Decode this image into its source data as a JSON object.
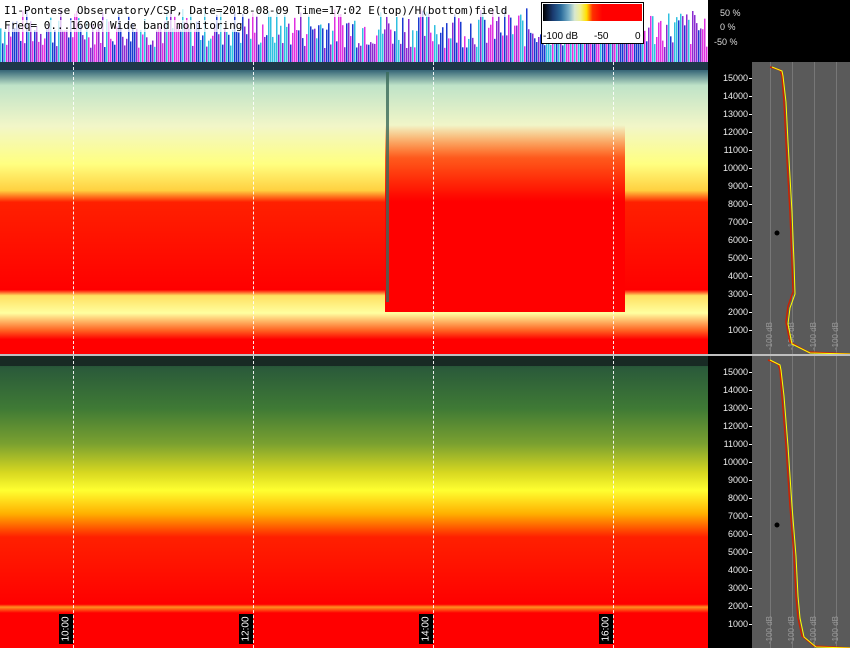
{
  "header": {
    "title": "I1-Pontese Observatory/CSP, Date=2018-08-09 Time=17:02 E(top)/H(bottom)field",
    "subtitle": "Freq= 0...16000 Wide band monitoring"
  },
  "colorbar": {
    "min_label": "-100 dB",
    "mid_label": "-50",
    "max_label": "0"
  },
  "percent_scale": [
    "50 %",
    "0 %",
    "-50 %"
  ],
  "frequency_axis": {
    "labels": [
      "15000",
      "14000",
      "13000",
      "12000",
      "11000",
      "10000",
      "9000",
      "8000",
      "7000",
      "6000",
      "5000",
      "4000",
      "3000",
      "2000",
      "1000"
    ]
  },
  "profile_ticks": [
    "-100 dB",
    "-100 dB",
    "-100 dB",
    "-100 dB"
  ],
  "time_labels": [
    "10:00",
    "12:00",
    "14:00",
    "16:00"
  ],
  "colors": {
    "red": "#ff0000",
    "yellow": "#ffff60",
    "green": "#2f7a3a",
    "profile_yellow": "#ffff00",
    "profile_red": "#cc2200"
  }
}
